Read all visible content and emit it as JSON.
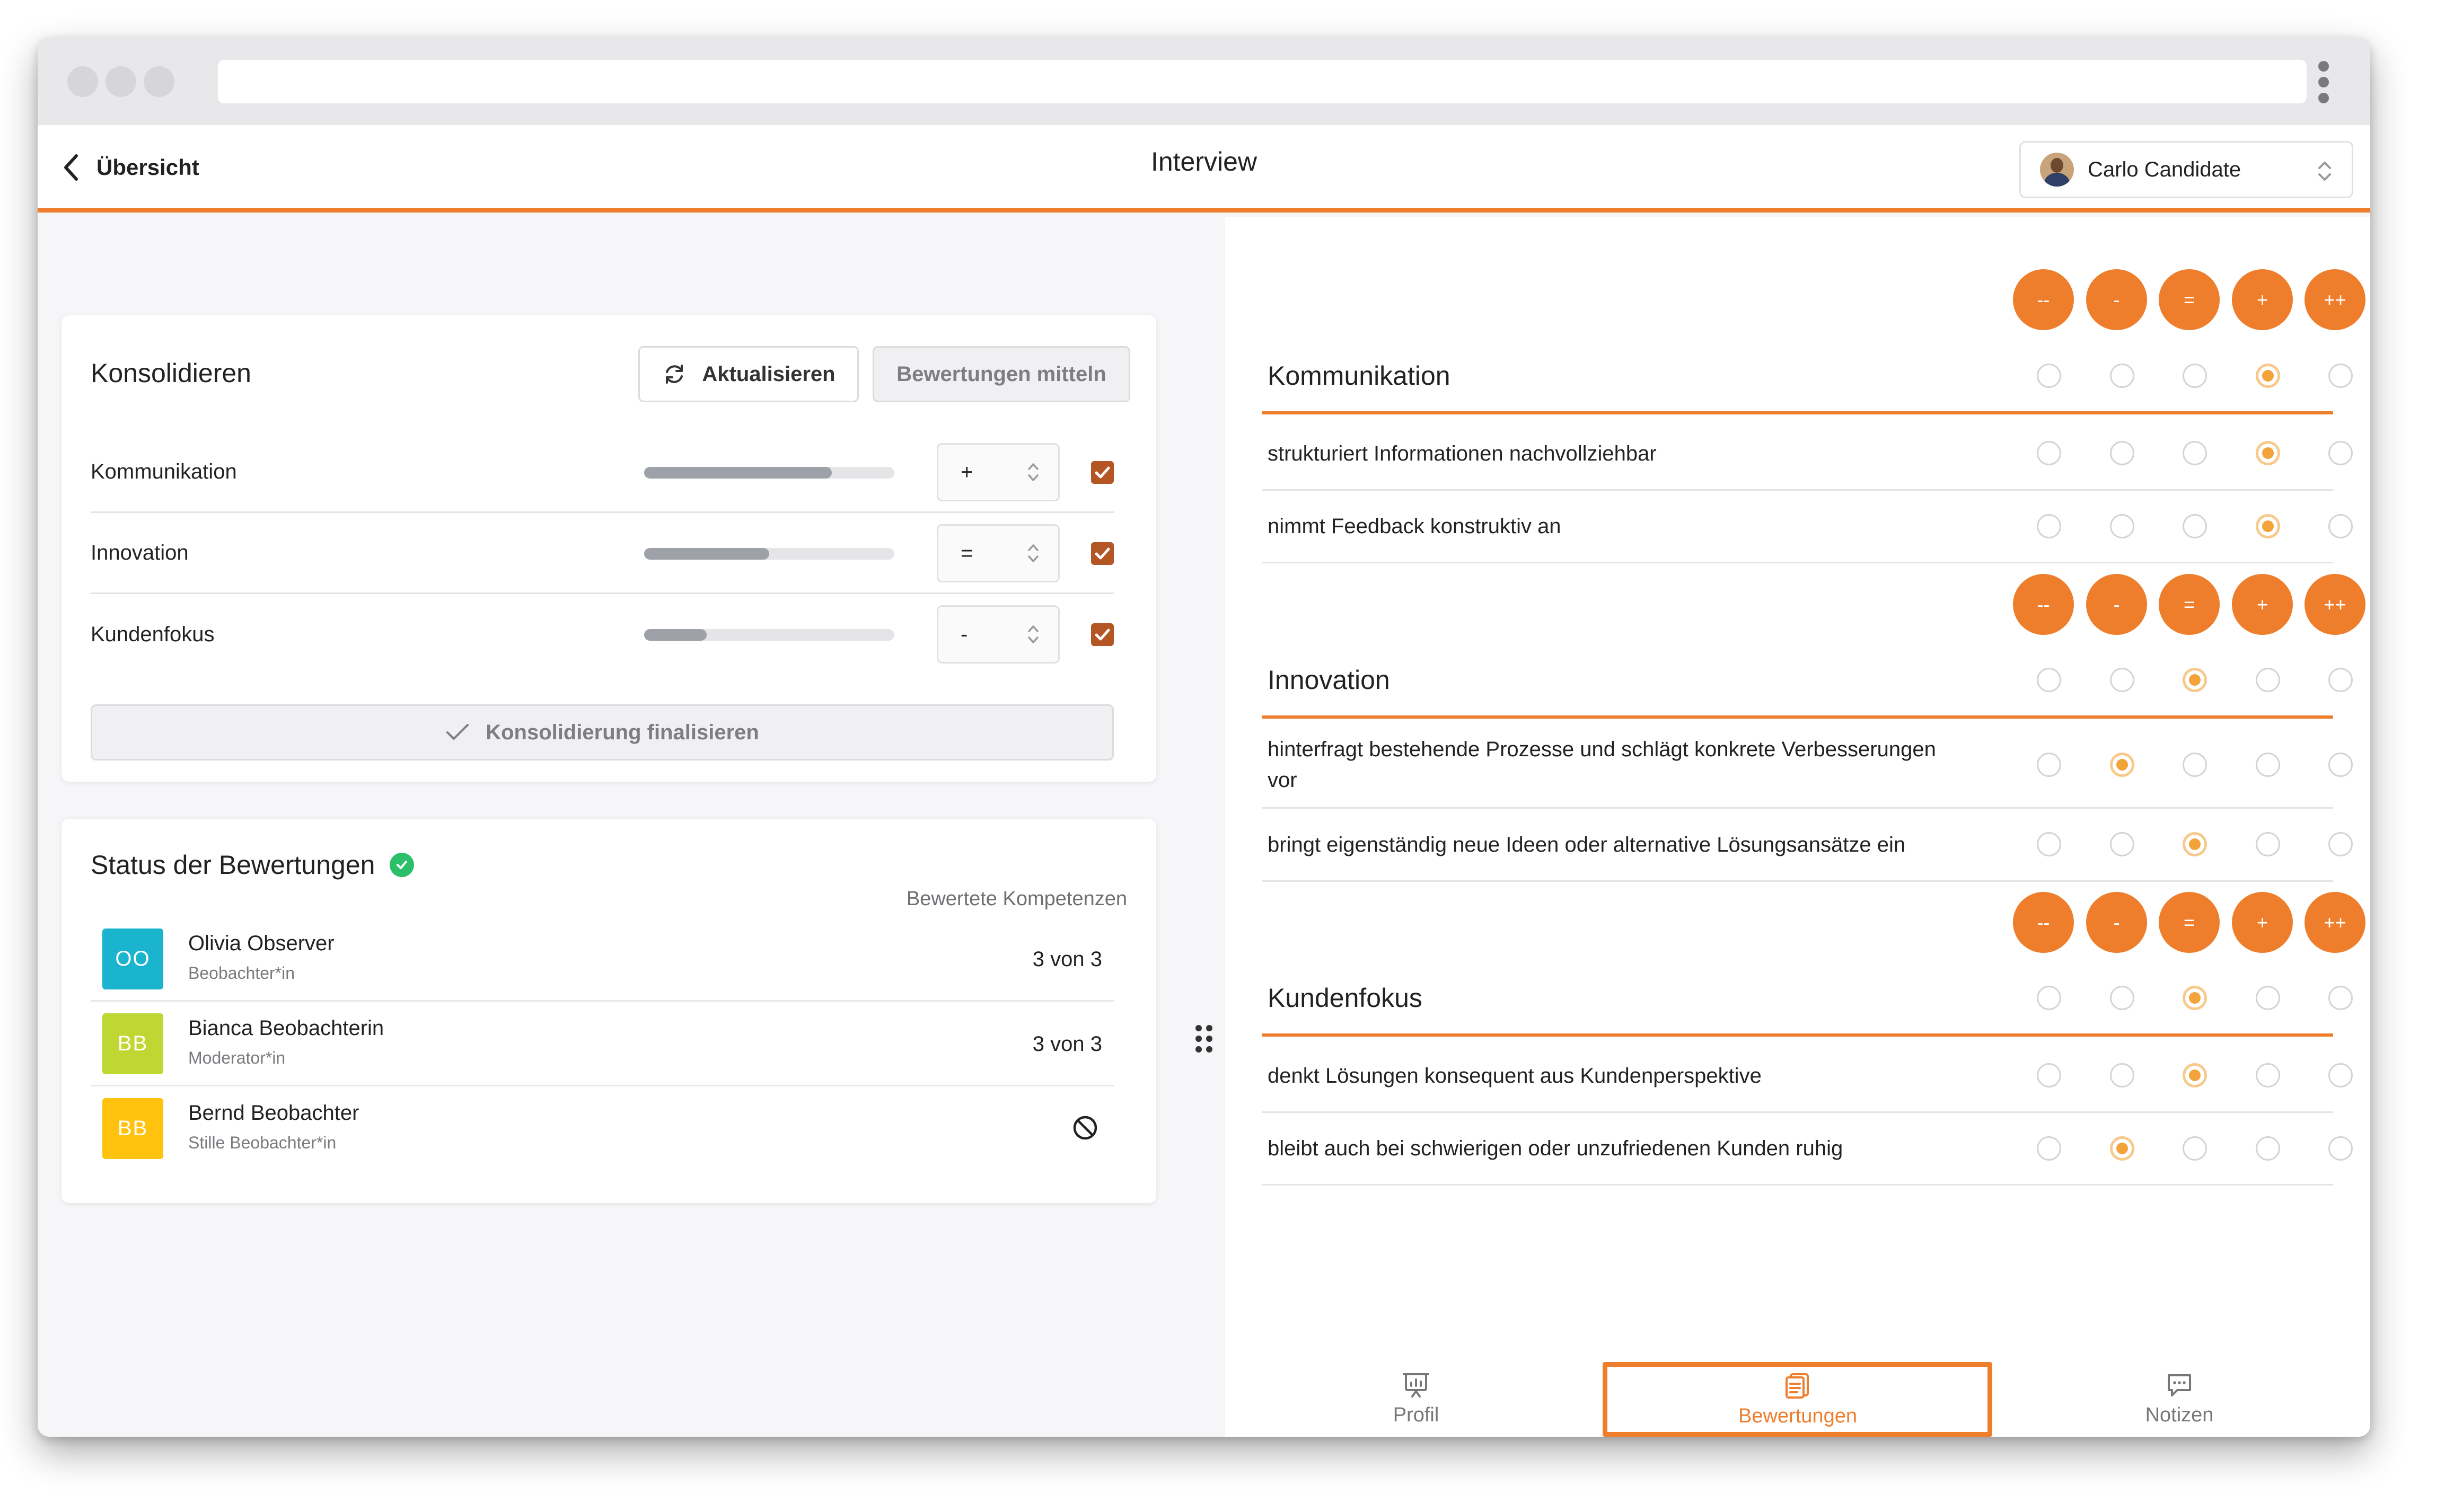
{
  "header": {
    "back_label": "Übersicht",
    "title": "Interview",
    "candidate": "Carlo Candidate"
  },
  "consolidate": {
    "title": "Konsolidieren",
    "refresh_label": "Aktualisieren",
    "average_label": "Bewertungen mitteln",
    "finalize_label": "Konsolidierung finalisieren",
    "rows": [
      {
        "label": "Kommunikation",
        "value": "+",
        "progress": 0.75,
        "checked": true
      },
      {
        "label": "Innovation",
        "value": "=",
        "progress": 0.5,
        "checked": true
      },
      {
        "label": "Kundenfokus",
        "value": "-",
        "progress": 0.25,
        "checked": true
      }
    ]
  },
  "status": {
    "title": "Status der Bewertungen",
    "column_header": "Bewertete Kompetenzen",
    "people": [
      {
        "initials": "OO",
        "name": "Olivia Observer",
        "role": "Beobachter*in",
        "count": "3 von 3",
        "color": "#1ab4cf"
      },
      {
        "initials": "BB",
        "name": "Bianca Beobachterin",
        "role": "Moderator*in",
        "count": "3 von 3",
        "color": "#bfd733"
      },
      {
        "initials": "BB",
        "name": "Bernd Beobachter",
        "role": "Stille Beobachter*in",
        "count": "",
        "color": "#ffc20e"
      }
    ]
  },
  "scale": [
    "--",
    "-",
    "=",
    "+",
    "++"
  ],
  "competencies": [
    {
      "title": "Kommunikation",
      "selected": 3,
      "behaviors": [
        {
          "text": "strukturiert Informationen nachvollziehbar",
          "selected": 3
        },
        {
          "text": "nimmt Feedback konstruktiv an",
          "selected": 3
        }
      ]
    },
    {
      "title": "Innovation",
      "selected": 2,
      "behaviors": [
        {
          "text": "hinterfragt bestehende Prozesse und schlägt konkrete Verbesserungen vor",
          "selected": 1
        },
        {
          "text": "bringt eigenständig neue Ideen oder alternative Lösungsansätze ein",
          "selected": 2
        }
      ]
    },
    {
      "title": "Kundenfokus",
      "selected": 2,
      "behaviors": [
        {
          "text": "denkt Lösungen konsequent aus Kundenperspektive",
          "selected": 2
        },
        {
          "text": "bleibt auch bei schwierigen oder unzufriedenen Kunden ruhig",
          "selected": 1
        }
      ]
    }
  ],
  "bottom_nav": [
    {
      "label": "Profil",
      "icon": "presentation-icon",
      "active": false
    },
    {
      "label": "Bewertungen",
      "icon": "clipboard-icon",
      "active": true
    },
    {
      "label": "Notizen",
      "icon": "chat-icon",
      "active": false
    }
  ],
  "colors": {
    "accent": "#ee7e2c",
    "checkbox": "#b35623",
    "radio_selected": "#f2a33a",
    "success": "#2bbf6a"
  }
}
